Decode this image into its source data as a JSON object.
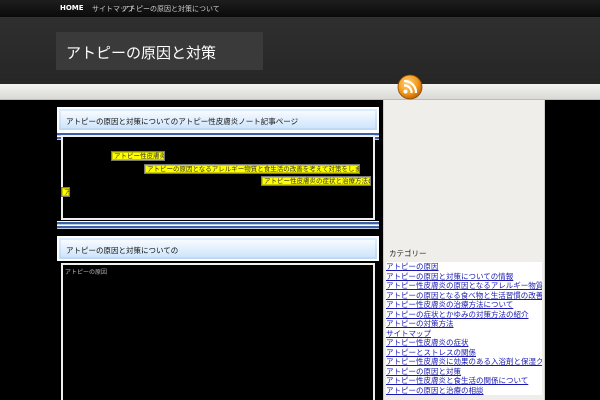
{
  "nav": {
    "home": "HOME",
    "item2": "サイトマップ",
    "item3": "アトピーの原因と対策について"
  },
  "site": {
    "title": "アトピーの原因と対策"
  },
  "posts": [
    {
      "title": "アトピーの原因と対策についてのアトピー性皮膚炎ノート記事ページ",
      "highlights": [
        "アトピー性皮膚炎の原因",
        "アトピーの原因となるアレルギー物質と食生活の改善を考えて対策をしましょう",
        "アトピー性皮膚炎の症状と治療方法の相談はこちら",
        "ア"
      ]
    },
    {
      "title": "アトピーの原因と対策についての",
      "text": "アトピーの原因"
    }
  ],
  "sidebar": {
    "title": "カテゴリー",
    "links": [
      "アトピーの原因",
      "アトピーの原因と対策についての情報",
      "アトピー性皮膚炎の原因となるアレルギー物質",
      "アトピーの原因となる食べ物と生活習慣の改善",
      "アトピー性皮膚炎の治療方法について",
      "アトピーの症状とかゆみの対策方法の紹介",
      "アトピーの対策方法",
      "サイトマップ",
      "アトピー性皮膚炎の症状",
      "アトピーとストレスの関係",
      "アトピー性皮膚炎に効果のある入浴剤と保湿クリーム",
      "アトピーの原因と対策",
      "アトピー性皮膚炎と食生活の関係について",
      "アトピーの原因と治療の相談"
    ]
  },
  "colors": {
    "highlight": "#ffff00",
    "link": "#1a1ab0",
    "rss": "#f39a1d"
  }
}
